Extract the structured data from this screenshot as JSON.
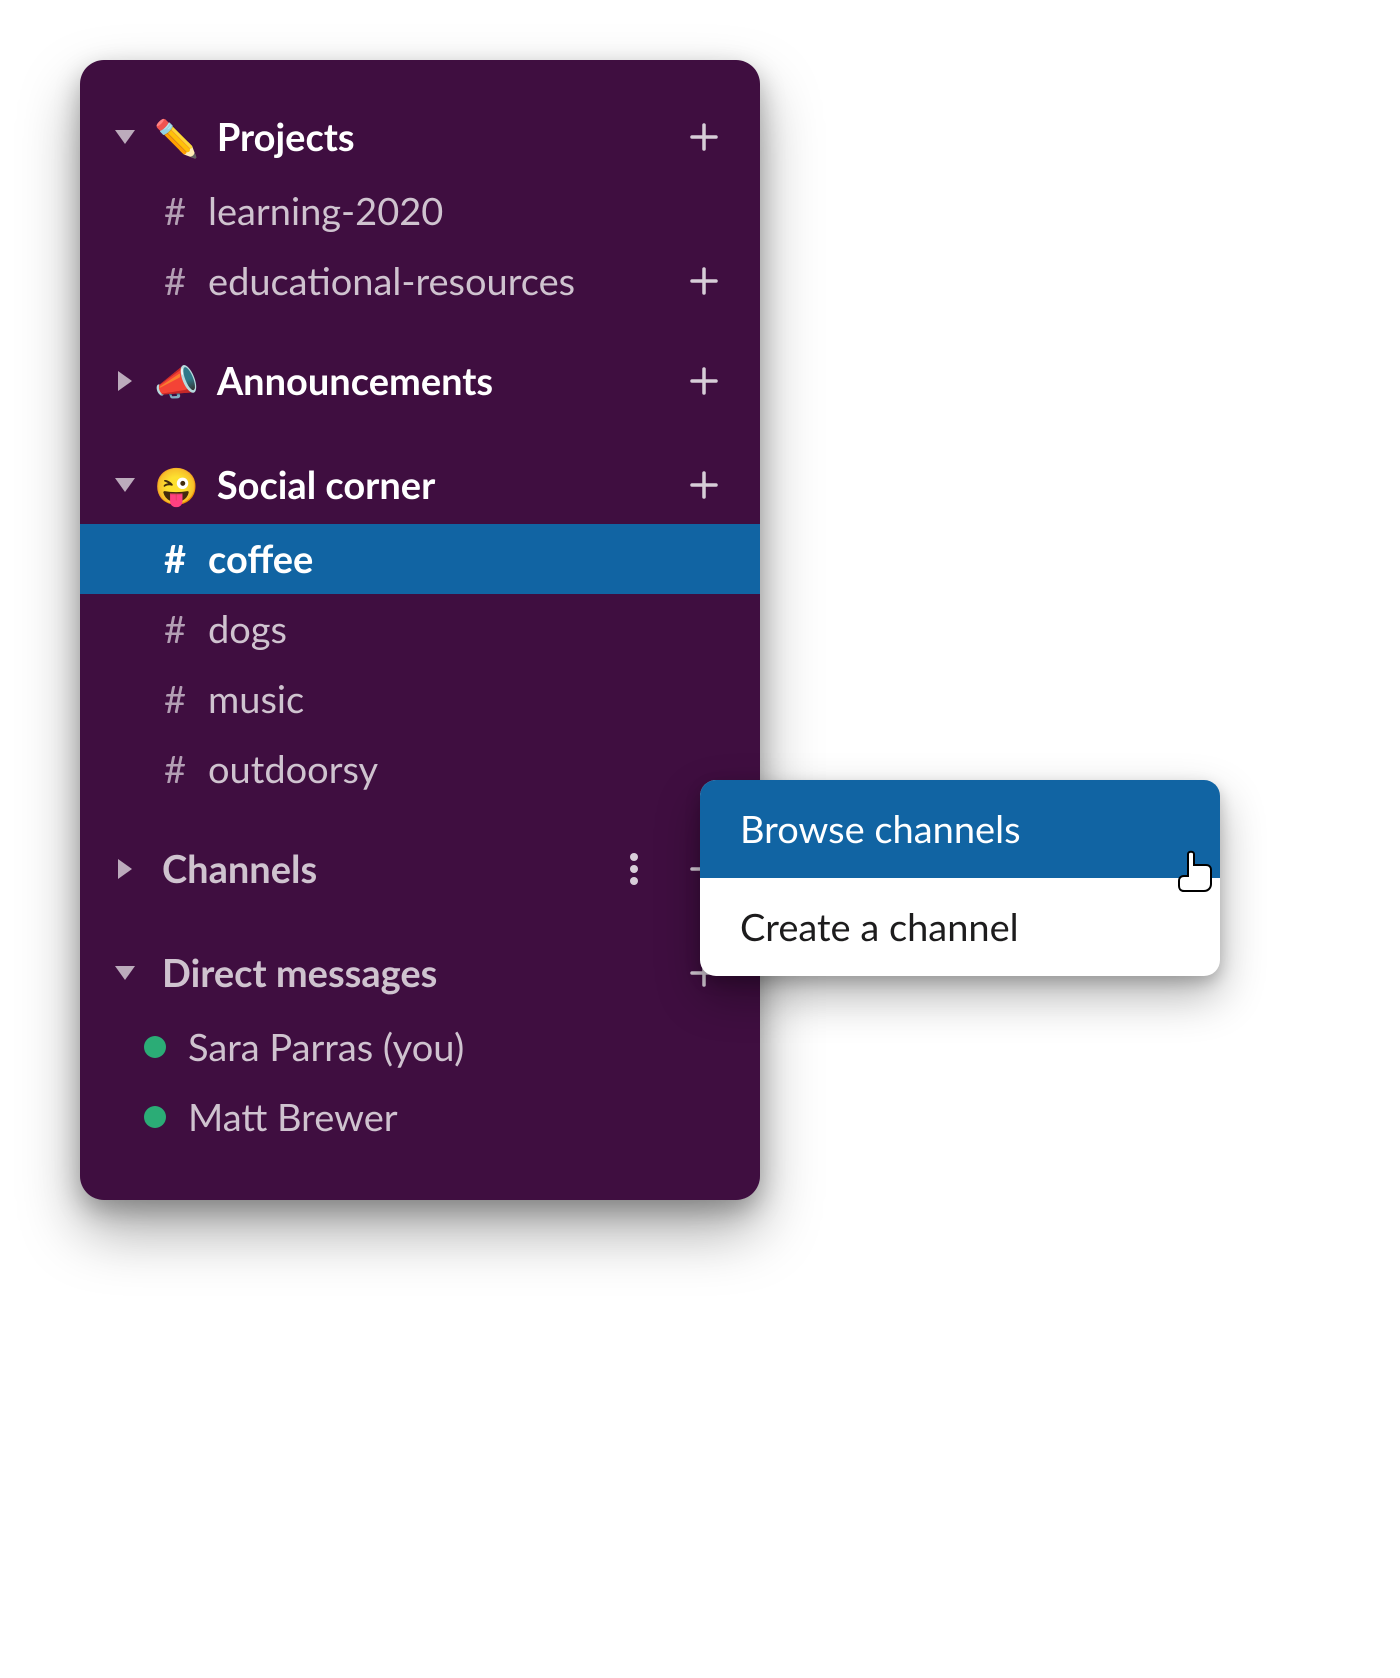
{
  "sidebar": {
    "sections": [
      {
        "id": "projects",
        "label": "Projects",
        "emoji": "pencil",
        "expanded": true,
        "show_add": true,
        "channels": [
          {
            "name": "learning-2020",
            "selected": false,
            "show_add": false
          },
          {
            "name": "educational-resources",
            "selected": false,
            "show_add": true
          }
        ]
      },
      {
        "id": "announcements",
        "label": "Announcements",
        "emoji": "megaphone",
        "expanded": false,
        "show_add": true,
        "channels": []
      },
      {
        "id": "social",
        "label": "Social corner",
        "emoji": "zany",
        "expanded": true,
        "show_add": true,
        "channels": [
          {
            "name": "coffee",
            "selected": true
          },
          {
            "name": "dogs",
            "selected": false
          },
          {
            "name": "music",
            "selected": false
          },
          {
            "name": "outdoorsy",
            "selected": false
          }
        ]
      },
      {
        "id": "channels",
        "label": "Channels",
        "expanded": false,
        "show_add": true,
        "show_more": true,
        "channels": []
      },
      {
        "id": "dms",
        "label": "Direct messages",
        "expanded": true,
        "show_add": true,
        "dms": [
          {
            "name": "Sara Parras (you)"
          },
          {
            "name": "Matt Brewer"
          }
        ]
      }
    ]
  },
  "popover": {
    "items": [
      {
        "label": "Browse channels",
        "highlight": true
      },
      {
        "label": "Create a channel",
        "highlight": false
      }
    ]
  }
}
